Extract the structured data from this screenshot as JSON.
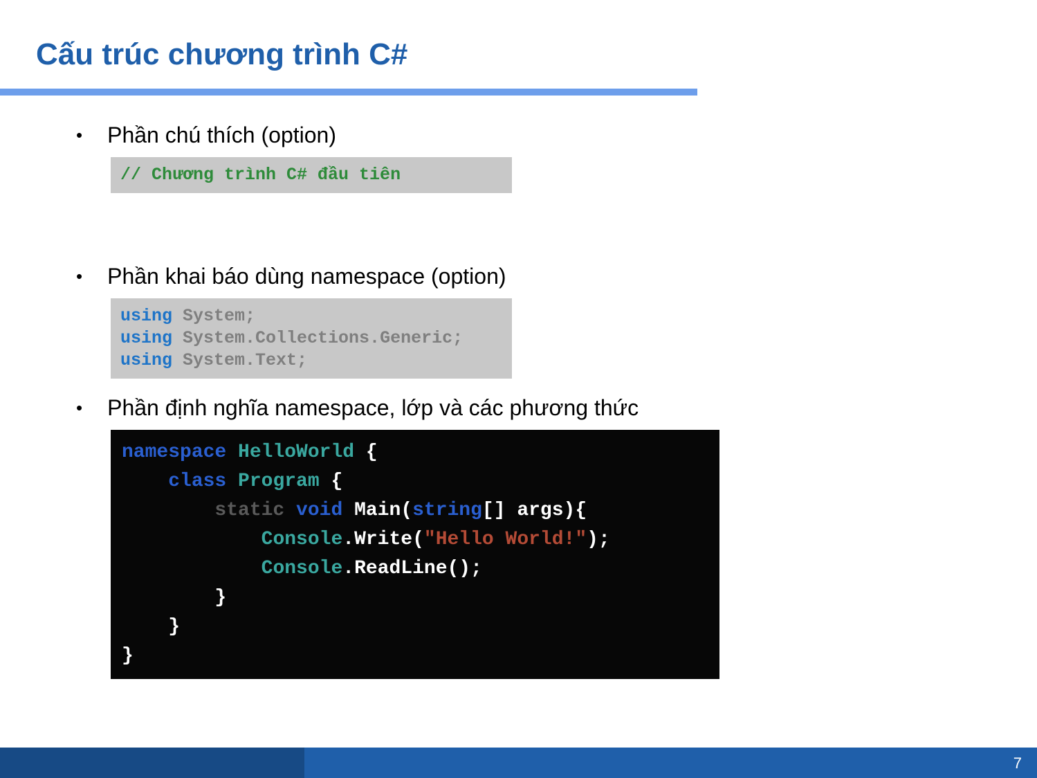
{
  "slide": {
    "title": "Cấu trúc chương trình C#",
    "page_number": "7"
  },
  "bullets": {
    "b1": "Phần chú thích (option)",
    "b2": "Phần khai báo dùng namespace (option)",
    "b3": "Phần định nghĩa namespace, lớp và các phương thức"
  },
  "code1": {
    "line1": "// Chương trình C# đầu tiên"
  },
  "code2": {
    "kw": "using",
    "l1": " System;",
    "l2": " System.Collections.Generic;",
    "l3": " System.Text;"
  },
  "code3": {
    "ns_kw": "namespace",
    "ns_name": " HelloWorld ",
    "brace_open": "{",
    "indent1": "    ",
    "class_kw": "class",
    "class_name": " Program ",
    "indent2": "        ",
    "static_kw": "static",
    "void_kw": " void",
    "main_sig_pre": " Main(",
    "string_kw": "string",
    "main_sig_post": "[] args){",
    "indent3": "            ",
    "console": "Console",
    "write_call": ".Write(",
    "hello_str": "\"Hello World!\"",
    "write_close": ");",
    "readline": ".ReadLine();",
    "brace_close2": "        }",
    "brace_close1": "    }",
    "brace_close0": "}"
  }
}
